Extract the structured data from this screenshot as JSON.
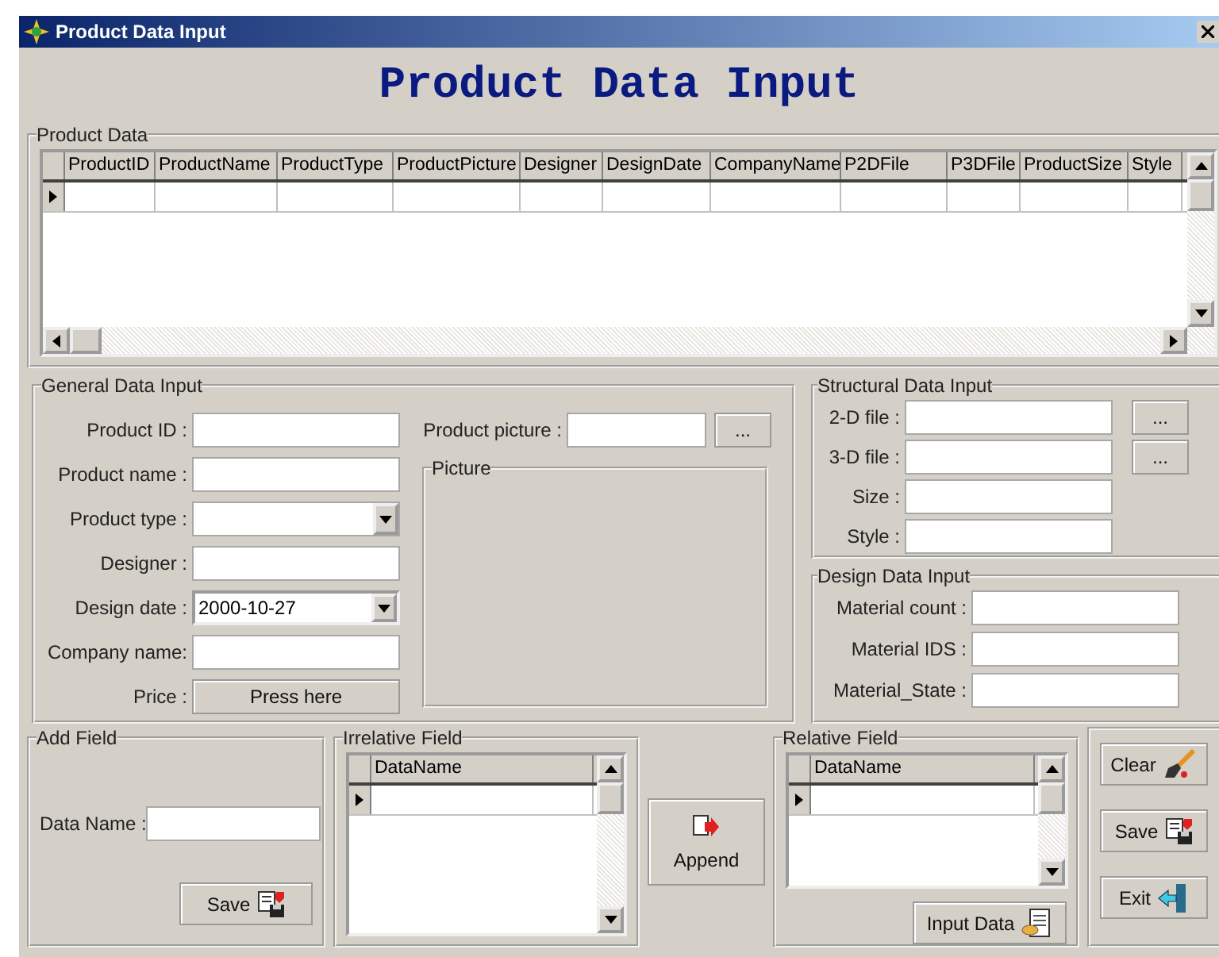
{
  "window": {
    "title": "Product Data Input"
  },
  "heading": "Product Data Input",
  "product_data": {
    "label": "Product Data",
    "columns": [
      "ProductID",
      "ProductName",
      "ProductType",
      "ProductPicture",
      "Designer",
      "DesignDate",
      "CompanyName",
      "P2DFile",
      "P3DFile",
      "ProductSize",
      "Style"
    ]
  },
  "general": {
    "label": "General Data Input",
    "fields": [
      {
        "kind": "text",
        "label": "Product ID :"
      },
      {
        "kind": "text",
        "label": "Product name :"
      },
      {
        "kind": "combo",
        "label": "Product type :"
      },
      {
        "kind": "text",
        "label": "Designer :"
      },
      {
        "kind": "date",
        "label": "Design date :",
        "value": "2000-10-27"
      },
      {
        "kind": "text",
        "label": "Company name:"
      },
      {
        "kind": "button",
        "label": "Price :",
        "button": "Press here"
      }
    ],
    "picture_field": {
      "label": "Product picture :",
      "button": "..."
    },
    "picture_box": {
      "label": "Picture"
    }
  },
  "structural": {
    "label": "Structural Data Input",
    "fields": [
      {
        "label": "2-D file :",
        "button": "..."
      },
      {
        "label": "3-D file :",
        "button": "..."
      },
      {
        "label": "Size :"
      },
      {
        "label": "Style :"
      }
    ]
  },
  "design": {
    "label": "Design Data Input",
    "fields": [
      {
        "label": "Material count :"
      },
      {
        "label": "Material IDS :"
      },
      {
        "label": "Material_State :"
      }
    ]
  },
  "add_field": {
    "label": "Add Field",
    "field_label": "Data Name :",
    "button": "Save"
  },
  "irrelative_field": {
    "label": "Irrelative Field",
    "column": "DataName"
  },
  "append_button": "Append",
  "relative_field": {
    "label": "Relative Field",
    "column": "DataName",
    "button": "Input Data"
  },
  "actions": [
    {
      "kind": "clear",
      "label": "Clear"
    },
    {
      "kind": "save",
      "label": "Save"
    },
    {
      "kind": "exit",
      "label": "Exit"
    }
  ]
}
